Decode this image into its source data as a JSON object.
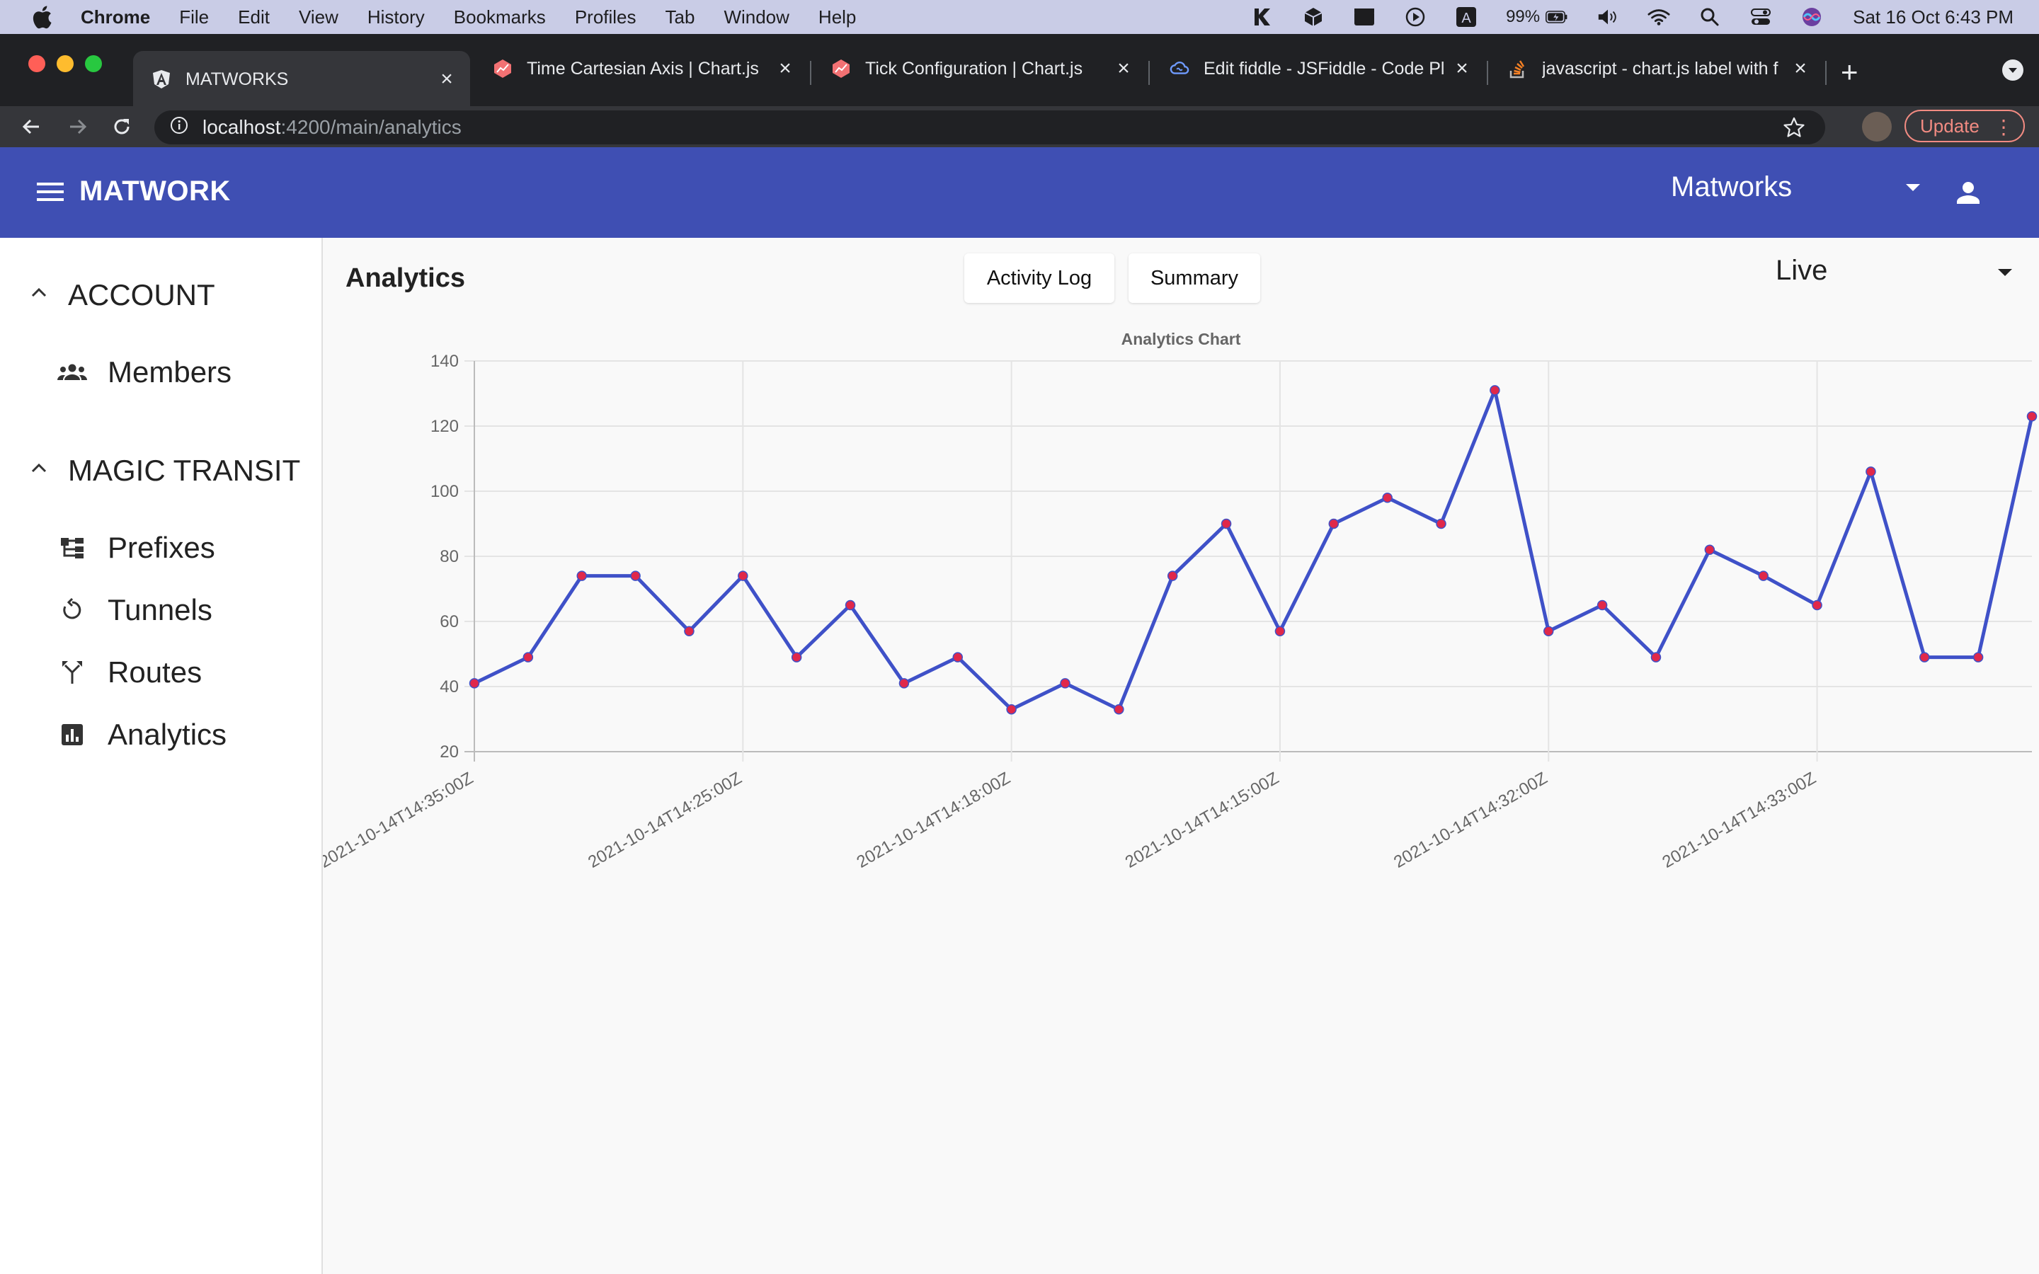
{
  "menubar": {
    "app_name": "Chrome",
    "items": [
      "File",
      "Edit",
      "View",
      "History",
      "Bookmarks",
      "Profiles",
      "Tab",
      "Window",
      "Help"
    ],
    "battery": "99%",
    "clock": "Sat 16 Oct  6:43 PM"
  },
  "browser": {
    "tabs": [
      {
        "title": "MATWORKS",
        "favicon": "angular-icon"
      },
      {
        "title": "Time Cartesian Axis | Chart.js",
        "favicon": "chartjs-icon"
      },
      {
        "title": "Tick Configuration | Chart.js",
        "favicon": "chartjs-icon"
      },
      {
        "title": "Edit fiddle - JSFiddle - Code Pl",
        "favicon": "jsfiddle-icon"
      },
      {
        "title": "javascript - chart.js label with f",
        "favicon": "stackoverflow-icon"
      }
    ],
    "url_host": "localhost",
    "url_path": ":4200/main/analytics",
    "update_label": "Update"
  },
  "header": {
    "brand": "MATWORK",
    "org": "Matworks"
  },
  "sidebar": {
    "sections": [
      {
        "label": "ACCOUNT",
        "items": [
          {
            "label": "Members",
            "icon": "people-icon"
          }
        ]
      },
      {
        "label": "MAGIC TRANSIT",
        "items": [
          {
            "label": "Prefixes",
            "icon": "hierarchy-icon"
          },
          {
            "label": "Tunnels",
            "icon": "loop-icon"
          },
          {
            "label": "Routes",
            "icon": "merge-icon"
          },
          {
            "label": "Analytics",
            "icon": "analytics-icon"
          }
        ]
      }
    ]
  },
  "main": {
    "title": "Analytics",
    "buttons": [
      "Activity Log",
      "Summary"
    ],
    "range": "Live"
  },
  "colors": {
    "header": "#3f4fb3",
    "line": "#3f51c8",
    "point": "#e0284a"
  },
  "chart_data": {
    "type": "line",
    "title": "Analytics Chart",
    "xlabel": "",
    "ylabel": "",
    "ylim": [
      20,
      140
    ],
    "y_ticks": [
      20,
      40,
      60,
      80,
      100,
      120,
      140
    ],
    "x_tick_labels": [
      "2021-10-14T14:35:00Z",
      "2021-10-14T14:25:00Z",
      "2021-10-14T14:18:00Z",
      "2021-10-14T14:15:00Z",
      "2021-10-14T14:32:00Z",
      "2021-10-14T14:33:00Z"
    ],
    "grid": true,
    "legend": "none",
    "values": [
      41,
      49,
      74,
      74,
      57,
      74,
      49,
      65,
      41,
      49,
      33,
      41,
      33,
      74,
      90,
      57,
      90,
      98,
      90,
      131,
      57,
      65,
      49,
      82,
      74,
      65,
      106,
      49,
      49,
      123
    ]
  }
}
